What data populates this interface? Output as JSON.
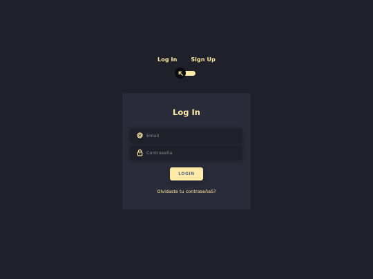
{
  "colors": {
    "background": "#1f2029",
    "card": "#2a2b38",
    "accent": "#ffeba7",
    "button_text": "#5e6681"
  },
  "mode_switch": {
    "login_label": "Log In",
    "signup_label": "Sign Up",
    "knob_icon": "arrow-up-left-icon"
  },
  "card": {
    "title": "Log In",
    "email": {
      "icon": "at-icon",
      "placeholder": "Email",
      "value": ""
    },
    "password": {
      "icon": "lock-icon",
      "placeholder": "Contraseña",
      "value": ""
    },
    "login_button_label": "LOGIN",
    "forgot_link_label": "Olvidaste tu contraseñaS?"
  }
}
